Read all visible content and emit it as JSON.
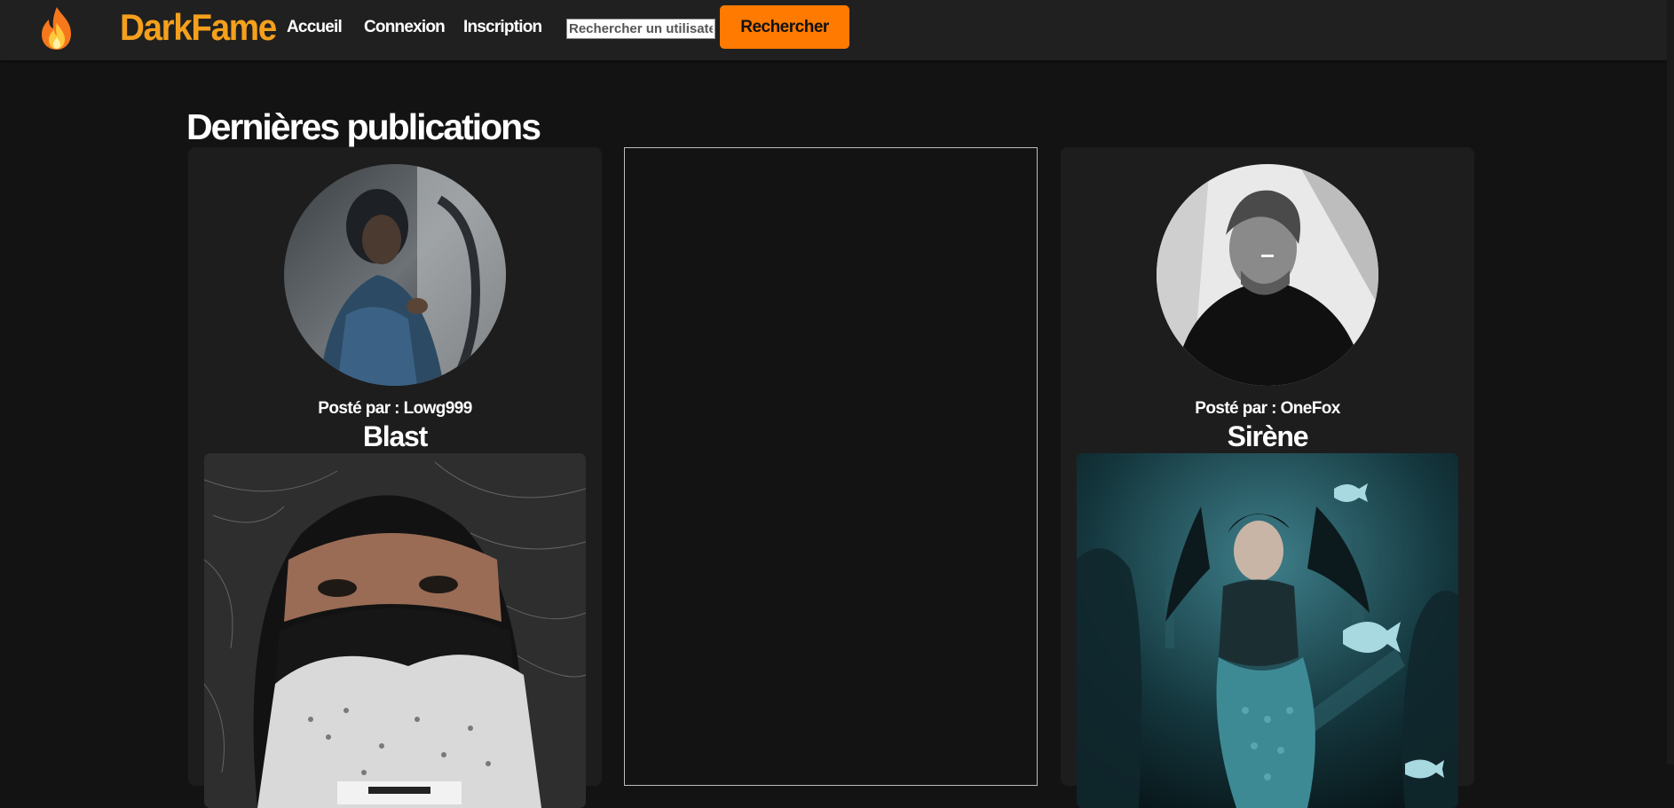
{
  "header": {
    "logo_icon": "flame-icon",
    "brand": "DarkFame",
    "nav": {
      "home": "Accueil",
      "login": "Connexion",
      "signup": "Inscription"
    },
    "search": {
      "placeholder": "Rechercher un utilisateur",
      "button_label": "Rechercher"
    },
    "colors": {
      "brand": "#f5a01c",
      "button": "#ff7a00"
    }
  },
  "main": {
    "title": "Dernières publications",
    "posts": [
      {
        "posted_prefix": "Posté par :",
        "author": "Lowg999",
        "title": "Blast"
      },
      {},
      {
        "posted_prefix": "Posté par :",
        "author": "OneFox",
        "title": "Sirène"
      }
    ]
  }
}
